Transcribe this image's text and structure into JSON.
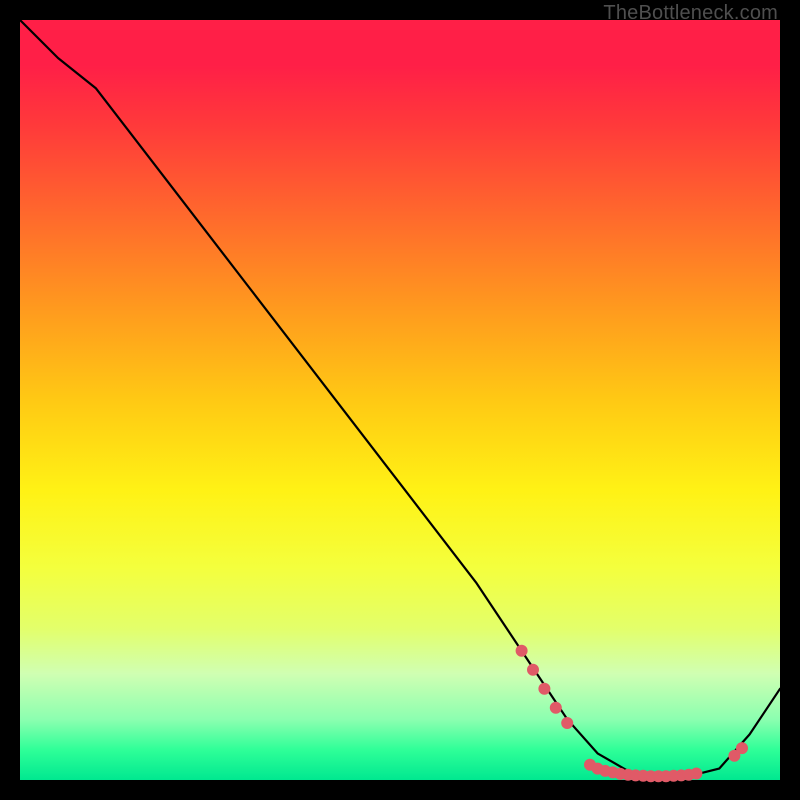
{
  "attribution": "TheBottleneck.com",
  "colors": {
    "frame": "#000000",
    "curve": "#000000",
    "marker": "#e05a67"
  },
  "chart_data": {
    "type": "line",
    "title": "",
    "xlabel": "",
    "ylabel": "",
    "xlim": [
      0,
      100
    ],
    "ylim": [
      0,
      100
    ],
    "background": "vertical-gradient red→orange→yellow→green",
    "series": [
      {
        "name": "bottleneck-curve",
        "x": [
          0,
          5,
          10,
          20,
          30,
          40,
          50,
          60,
          68,
          72,
          76,
          80,
          84,
          88,
          92,
          96,
          100
        ],
        "y": [
          100,
          95,
          91,
          78,
          65,
          52,
          39,
          26,
          14,
          8,
          3.5,
          1.2,
          0.5,
          0.5,
          1.5,
          6,
          12
        ]
      }
    ],
    "markers": [
      {
        "x": 66,
        "y": 17
      },
      {
        "x": 67.5,
        "y": 14.5
      },
      {
        "x": 69,
        "y": 12
      },
      {
        "x": 70.5,
        "y": 9.5
      },
      {
        "x": 72,
        "y": 7.5
      },
      {
        "x": 75,
        "y": 2.0
      },
      {
        "x": 76,
        "y": 1.5
      },
      {
        "x": 77,
        "y": 1.2
      },
      {
        "x": 78,
        "y": 1.0
      },
      {
        "x": 79,
        "y": 0.8
      },
      {
        "x": 80,
        "y": 0.7
      },
      {
        "x": 81,
        "y": 0.6
      },
      {
        "x": 82,
        "y": 0.55
      },
      {
        "x": 83,
        "y": 0.5
      },
      {
        "x": 84,
        "y": 0.5
      },
      {
        "x": 85,
        "y": 0.5
      },
      {
        "x": 86,
        "y": 0.55
      },
      {
        "x": 87,
        "y": 0.6
      },
      {
        "x": 88,
        "y": 0.7
      },
      {
        "x": 89,
        "y": 0.85
      },
      {
        "x": 94,
        "y": 3.2
      },
      {
        "x": 95,
        "y": 4.2
      }
    ]
  }
}
